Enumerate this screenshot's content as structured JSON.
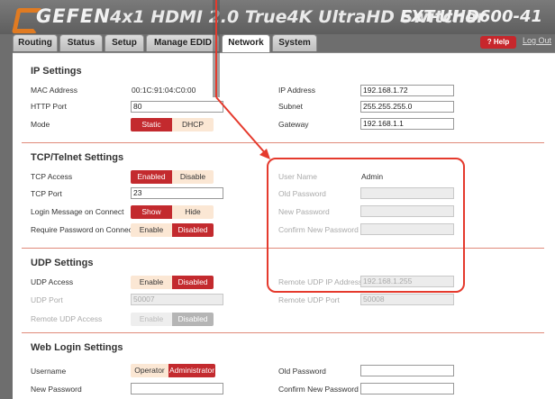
{
  "header": {
    "logo_text": "GEFEN",
    "product_title": "4x1 HDMI 2.0 True4K UltraHD Switcher",
    "model": "EXT-UHD600-41",
    "help_label": "? Help",
    "logout_label": "Log Out"
  },
  "tabs": [
    {
      "label": "Routing"
    },
    {
      "label": "Status"
    },
    {
      "label": "Setup"
    },
    {
      "label": "Manage EDID"
    },
    {
      "label": "Network",
      "active": true
    },
    {
      "label": "System"
    }
  ],
  "ip": {
    "title": "IP Settings",
    "mac_label": "MAC Address",
    "mac_value": "00:1C:91:04:C0:00",
    "http_label": "HTTP Port",
    "http_value": "80",
    "mode_label": "Mode",
    "mode_static": "Static",
    "mode_dhcp": "DHCP",
    "ip_label": "IP Address",
    "ip_value": "192.168.1.72",
    "subnet_label": "Subnet",
    "subnet_value": "255.255.255.0",
    "gateway_label": "Gateway",
    "gateway_value": "192.168.1.1"
  },
  "tcp": {
    "title": "TCP/Telnet Settings",
    "access_label": "TCP Access",
    "access_enabled": "Enabled",
    "access_disable": "Disable",
    "port_label": "TCP Port",
    "port_value": "23",
    "login_msg_label": "Login Message on Connect",
    "login_show": "Show",
    "login_hide": "Hide",
    "require_pw_label": "Require Password on Connect",
    "require_enable": "Enable",
    "require_disabled": "Disabled",
    "username_label": "User Name",
    "username_value": "Admin",
    "old_pw_label": "Old Password",
    "new_pw_label": "New Password",
    "confirm_pw_label": "Confirm New Password"
  },
  "udp": {
    "title": "UDP Settings",
    "access_label": "UDP Access",
    "access_enable": "Enable",
    "access_disabled": "Disabled",
    "port_label": "UDP Port",
    "port_value": "50007",
    "remote_access_label": "Remote UDP Access",
    "remote_enable": "Enable",
    "remote_disabled": "Disabled",
    "remote_ip_label": "Remote UDP IP Address",
    "remote_ip_value": "192.168.1.255",
    "remote_port_label": "Remote UDP Port",
    "remote_port_value": "50008"
  },
  "web": {
    "title": "Web Login Settings",
    "username_label": "Username",
    "user_operator": "Operator",
    "user_admin": "Administrator",
    "new_pw_label": "New Password",
    "old_pw_label": "Old Password",
    "confirm_pw_label": "Confirm New Password"
  },
  "colors": {
    "accent_red": "#c32a2e",
    "toggle_off": "#fbe7d4",
    "callout": "#e53a2d",
    "brand_orange": "#e07b22"
  }
}
